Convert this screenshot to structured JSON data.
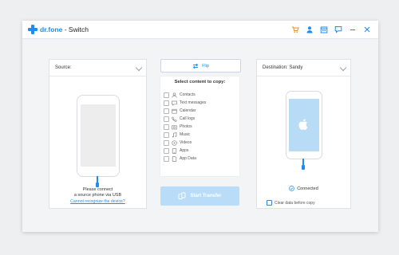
{
  "app": {
    "brand": "dr.fone",
    "separator": " - ",
    "module": "Switch"
  },
  "toolbar_icons": [
    "cart-icon",
    "account-icon",
    "calendar-icon",
    "feedback-icon",
    "minimize-icon",
    "close-icon"
  ],
  "source": {
    "header": "Source:",
    "prompt_line1": "Please connect",
    "prompt_line2": "a source phone via USB",
    "link": "Cannot recognize the device?"
  },
  "flip": {
    "label": "Flip"
  },
  "content": {
    "header": "Select content to copy:",
    "items": [
      {
        "label": "Contacts",
        "icon": "contacts-icon"
      },
      {
        "label": "Text messages",
        "icon": "messages-icon"
      },
      {
        "label": "Calendar",
        "icon": "calendar-icon"
      },
      {
        "label": "Call logs",
        "icon": "call-logs-icon"
      },
      {
        "label": "Photos",
        "icon": "camera-icon"
      },
      {
        "label": "Music",
        "icon": "music-icon"
      },
      {
        "label": "Videos",
        "icon": "video-icon"
      },
      {
        "label": "Apps",
        "icon": "apps-icon"
      },
      {
        "label": "App Data",
        "icon": "app-data-icon"
      }
    ]
  },
  "start": {
    "label": "Start Transfer"
  },
  "destination": {
    "header": "Destination: Sandy",
    "status": "Connected",
    "clear_label": "Clear data before copy"
  },
  "colors": {
    "accent": "#1e8cf0",
    "disabled_button": "#b9dcf8",
    "phone_screen": "#b8dcf6"
  }
}
